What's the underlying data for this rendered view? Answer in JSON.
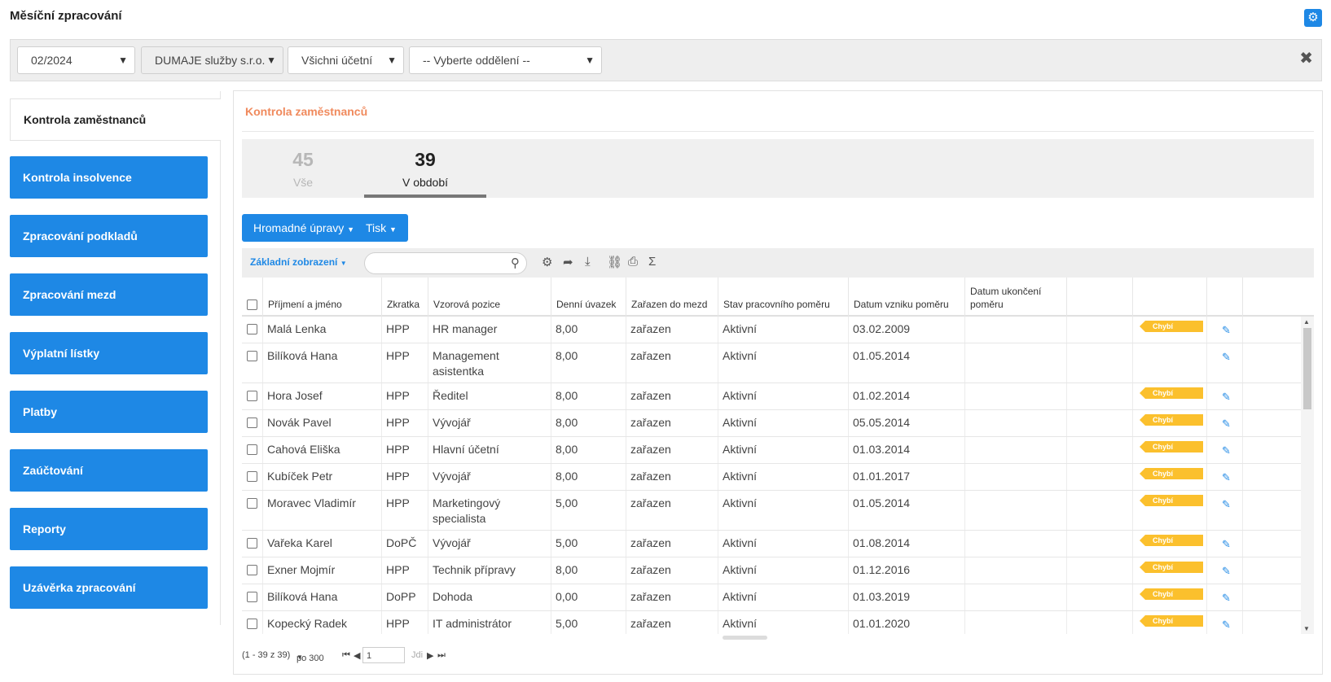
{
  "page": {
    "title": "Měsíční zpracování"
  },
  "filters": {
    "period": "02/2024",
    "company": "DUMAJE služby s.r.o.",
    "accountants": "Všichni účetní",
    "department": "-- Vyberte oddělení --"
  },
  "sidebar": {
    "items": [
      {
        "label": "Kontrola zaměstnanců",
        "active": true
      },
      {
        "label": "Kontrola insolvence"
      },
      {
        "label": "Zpracování podkladů"
      },
      {
        "label": "Zpracování mezd"
      },
      {
        "label": "Výplatní lístky"
      },
      {
        "label": "Platby"
      },
      {
        "label": "Zaúčtování"
      },
      {
        "label": "Reporty"
      },
      {
        "label": "Uzávěrka zpracování"
      }
    ]
  },
  "panel": {
    "title": "Kontrola zaměstnanců",
    "counters": [
      {
        "value": "45",
        "label": "Vše"
      },
      {
        "value": "39",
        "label": "V období"
      }
    ],
    "buttons": {
      "bulk": "Hromadné úpravy",
      "print": "Tisk"
    },
    "view": "Základní zobrazení",
    "search": {
      "placeholder": "",
      "value": ""
    }
  },
  "icons": {
    "gear": "gear-icon",
    "close": "close-icon",
    "search": "search-icon",
    "settings": "gear-icon",
    "share": "share-icon",
    "download": "download-icon",
    "link": "link-icon",
    "print": "print-icon",
    "sum": "sigma-icon",
    "edit": "edit-icon"
  },
  "colors": {
    "primary": "#1e88e5",
    "accent_title": "#f08a5d",
    "badge": "#fbc02d"
  },
  "table": {
    "columns": [
      "Příjmení a jméno",
      "Zkratka",
      "Vzorová pozice",
      "Denní úvazek",
      "Zařazen do mezd",
      "Stav pracovního poměru",
      "Datum vzniku poměru",
      "Datum ukončení poměru"
    ],
    "badge_text": "Chybí",
    "rows": [
      {
        "name": "Malá Lenka",
        "abbr": "HPP",
        "position": "HR manager",
        "hours": "8,00",
        "included": "zařazen",
        "status": "Aktivní",
        "start": "03.02.2009",
        "end": "",
        "badge": "Chybí"
      },
      {
        "name": "Bilíková Hana",
        "abbr": "HPP",
        "position": "Management asistentka",
        "hours": "8,00",
        "included": "zařazen",
        "status": "Aktivní",
        "start": "01.05.2014",
        "end": "",
        "badge": ""
      },
      {
        "name": "Hora Josef",
        "abbr": "HPP",
        "position": "Ředitel",
        "hours": "8,00",
        "included": "zařazen",
        "status": "Aktivní",
        "start": "01.02.2014",
        "end": "",
        "badge": "Chybí"
      },
      {
        "name": "Novák Pavel",
        "abbr": "HPP",
        "position": "Vývojář",
        "hours": "8,00",
        "included": "zařazen",
        "status": "Aktivní",
        "start": "05.05.2014",
        "end": "",
        "badge": "Chybí"
      },
      {
        "name": "Cahová Eliška",
        "abbr": "HPP",
        "position": "Hlavní účetní",
        "hours": "8,00",
        "included": "zařazen",
        "status": "Aktivní",
        "start": "01.03.2014",
        "end": "",
        "badge": "Chybí"
      },
      {
        "name": "Kubíček Petr",
        "abbr": "HPP",
        "position": "Vývojář",
        "hours": "8,00",
        "included": "zařazen",
        "status": "Aktivní",
        "start": "01.01.2017",
        "end": "",
        "badge": "Chybí"
      },
      {
        "name": "Moravec Vladimír",
        "abbr": "HPP",
        "position": "Marketingový specialista",
        "hours": "5,00",
        "included": "zařazen",
        "status": "Aktivní",
        "start": "01.05.2014",
        "end": "",
        "badge": "Chybí"
      },
      {
        "name": "Vařeka Karel",
        "abbr": "DoPČ",
        "position": "Vývojář",
        "hours": "5,00",
        "included": "zařazen",
        "status": "Aktivní",
        "start": "01.08.2014",
        "end": "",
        "badge": "Chybí"
      },
      {
        "name": "Exner Mojmír",
        "abbr": "HPP",
        "position": "Technik přípravy",
        "hours": "8,00",
        "included": "zařazen",
        "status": "Aktivní",
        "start": "01.12.2016",
        "end": "",
        "badge": "Chybí"
      },
      {
        "name": "Bilíková Hana",
        "abbr": "DoPP",
        "position": "Dohoda",
        "hours": "0,00",
        "included": "zařazen",
        "status": "Aktivní",
        "start": "01.03.2019",
        "end": "",
        "badge": "Chybí"
      },
      {
        "name": "Kopecký Radek",
        "abbr": "HPP",
        "position": "IT administrátor",
        "hours": "5,00",
        "included": "zařazen",
        "status": "Aktivní",
        "start": "01.01.2020",
        "end": "",
        "badge": "Chybí"
      }
    ]
  },
  "pager": {
    "summary": "(1 - 39 z 39)",
    "per_page": "po 300",
    "page": "1",
    "go": "Jdi"
  }
}
